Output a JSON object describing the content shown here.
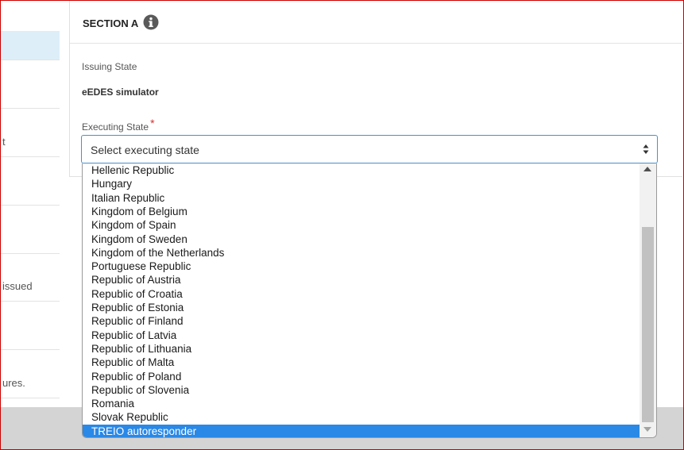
{
  "sidebar": {
    "items": [
      {
        "label": ""
      },
      {
        "label": ""
      },
      {
        "label": "t"
      },
      {
        "label": ""
      },
      {
        "label": ""
      },
      {
        "label": "issued"
      },
      {
        "label": ""
      },
      {
        "label": "ures."
      }
    ]
  },
  "section": {
    "title": "SECTION A",
    "info_icon": "info-icon",
    "issuing_state_label": "Issuing State",
    "issuing_state_value": "eEDES simulator",
    "executing_state_label": "Executing State",
    "required_mark": "*",
    "select_placeholder": "Select executing state"
  },
  "dropdown": {
    "options": [
      "Hellenic Republic",
      "Hungary",
      "Italian Republic",
      "Kingdom of Belgium",
      "Kingdom of Spain",
      "Kingdom of Sweden",
      "Kingdom of the Netherlands",
      "Portuguese Republic",
      "Republic of Austria",
      "Republic of Croatia",
      "Republic of Estonia",
      "Republic of Finland",
      "Republic of Latvia",
      "Republic of Lithuania",
      "Republic of Malta",
      "Republic of Poland",
      "Republic of Slovenia",
      "Romania",
      "Slovak Republic",
      "TREIO autoresponder"
    ],
    "highlighted": "TREIO autoresponder"
  },
  "colors": {
    "accent": "#2a88e6",
    "select_border": "#4a90c9",
    "required": "#d9302f",
    "sidebar_active": "#ddeef8",
    "frame": "#cc0000"
  }
}
